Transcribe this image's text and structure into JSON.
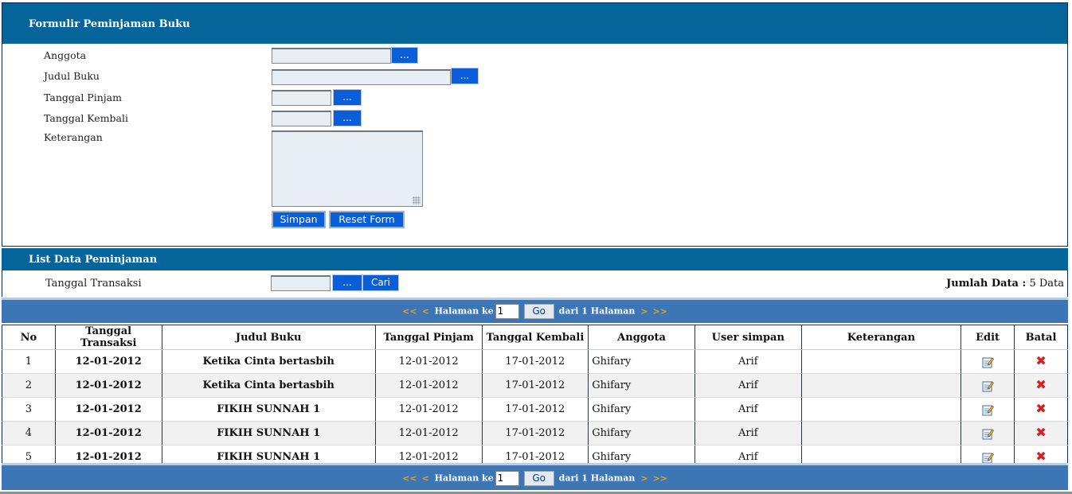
{
  "form": {
    "title": "Formulir Peminjaman Buku",
    "fields": {
      "anggota": "Anggota",
      "judul_buku": "Judul Buku",
      "tanggal_pinjam": "Tanggal Pinjam",
      "tanggal_kembali": "Tanggal Kembali",
      "keterangan": "Keterangan"
    },
    "browse_label": "...",
    "save_label": "Simpan",
    "reset_label": "Reset Form"
  },
  "list": {
    "title": "List Data Peminjaman",
    "filter_label": "Tanggal Transaksi",
    "search_label": "Cari",
    "browse_label": "...",
    "count_label": "Jumlah Data :",
    "count_value": "5 Data"
  },
  "pager": {
    "first": "<<",
    "prev": "<",
    "next": ">",
    "last": ">>",
    "page_label": "Halaman ke",
    "page_value": "1",
    "go_label": "Go",
    "of_label": "dari 1 Halaman"
  },
  "table": {
    "headers": [
      "No",
      "Tanggal Transaksi",
      "Judul Buku",
      "Tanggal Pinjam",
      "Tanggal Kembali",
      "Anggota",
      "User simpan",
      "Keterangan",
      "Edit",
      "Batal"
    ],
    "rows": [
      {
        "no": "1",
        "tgl_transaksi": "12-01-2012",
        "judul": "Ketika Cinta bertasbih",
        "tgl_pinjam": "12-01-2012",
        "tgl_kembali": "17-01-2012",
        "anggota": "Ghifary",
        "user": "Arif",
        "keterangan": ""
      },
      {
        "no": "2",
        "tgl_transaksi": "12-01-2012",
        "judul": "Ketika Cinta bertasbih",
        "tgl_pinjam": "12-01-2012",
        "tgl_kembali": "17-01-2012",
        "anggota": "Ghifary",
        "user": "Arif",
        "keterangan": ""
      },
      {
        "no": "3",
        "tgl_transaksi": "12-01-2012",
        "judul": "FIKIH SUNNAH 1",
        "tgl_pinjam": "12-01-2012",
        "tgl_kembali": "17-01-2012",
        "anggota": "Ghifary",
        "user": "Arif",
        "keterangan": ""
      },
      {
        "no": "4",
        "tgl_transaksi": "12-01-2012",
        "judul": "FIKIH SUNNAH 1",
        "tgl_pinjam": "12-01-2012",
        "tgl_kembali": "17-01-2012",
        "anggota": "Ghifary",
        "user": "Arif",
        "keterangan": ""
      },
      {
        "no": "5",
        "tgl_transaksi": "12-01-2012",
        "judul": "FIKIH SUNNAH 1",
        "tgl_pinjam": "12-01-2012",
        "tgl_kembali": "17-01-2012",
        "anggota": "Ghifary",
        "user": "Arif",
        "keterangan": ""
      }
    ]
  },
  "icons": {
    "edit": "edit-icon",
    "delete": "delete-icon"
  },
  "colors": {
    "header_bg": "#05659b",
    "pager_bg": "#3c76b5",
    "button_bg": "#0a5fd8",
    "delete_red": "#d42020"
  }
}
